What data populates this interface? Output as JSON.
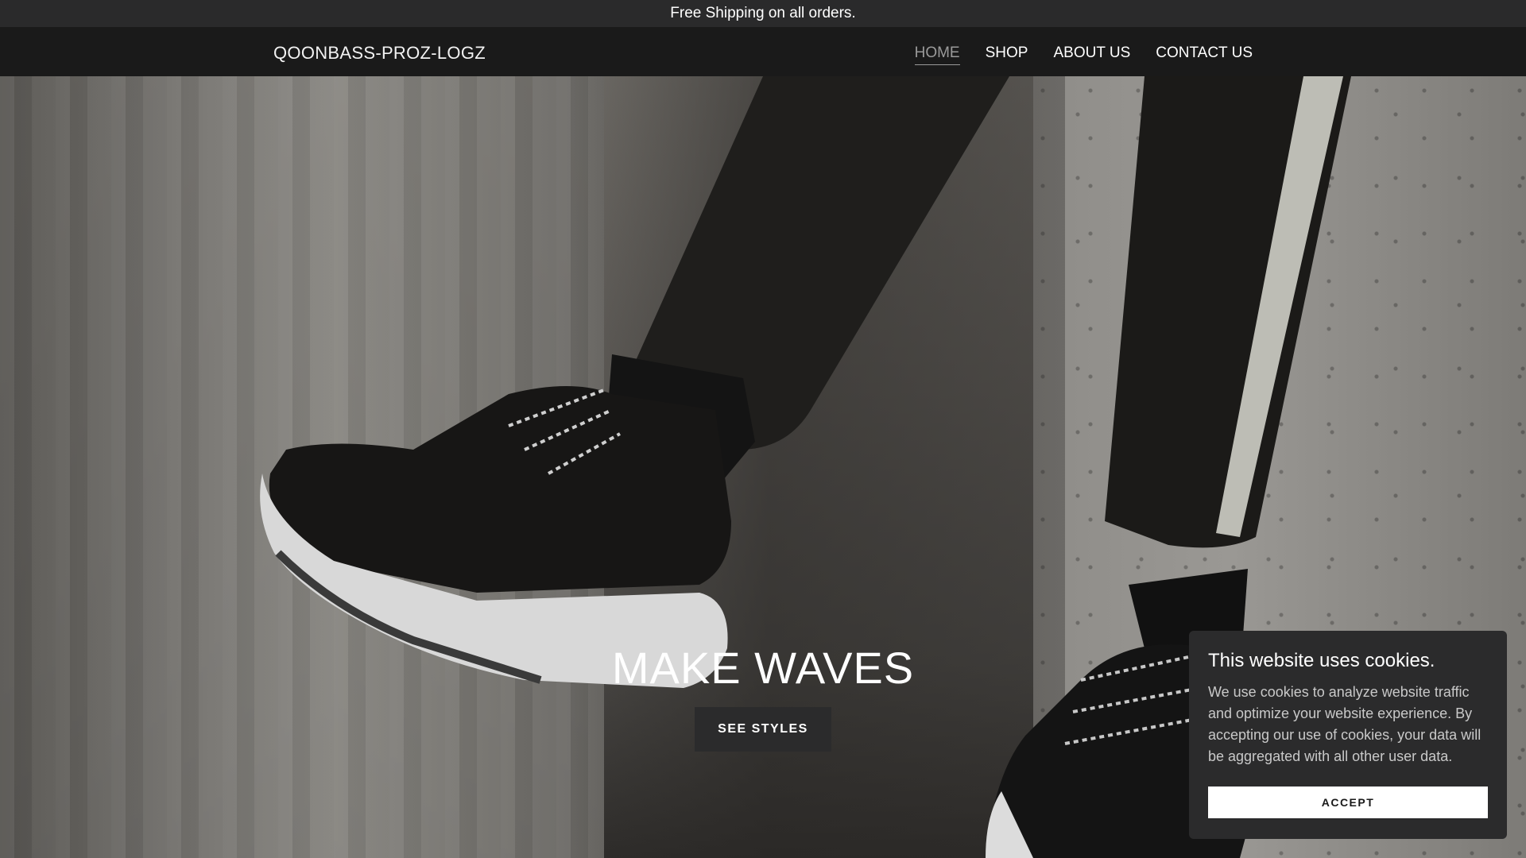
{
  "announcement": {
    "text": "Free Shipping on all orders."
  },
  "header": {
    "logo": "QOONBASS-PROZ-LOGZ",
    "nav": [
      {
        "label": "HOME",
        "active": true
      },
      {
        "label": "SHOP",
        "active": false
      },
      {
        "label": "ABOUT US",
        "active": false
      },
      {
        "label": "CONTACT US",
        "active": false
      }
    ]
  },
  "hero": {
    "title": "MAKE WAVES",
    "button_label": "SEE STYLES",
    "image": "sneakers-on-concrete-photo"
  },
  "cookie_banner": {
    "title": "This website uses cookies.",
    "text": "We use cookies to analyze website traffic and optimize your website experience. By accepting our use of cookies, your data will be aggregated with all other user data.",
    "accept_label": "ACCEPT"
  },
  "colors": {
    "announcement_bg": "#2a2a2b",
    "header_bg": "#1a1a1a",
    "button_bg": "#2b2b2c",
    "accent_inactive": "#9a9a9a",
    "text": "#ffffff"
  }
}
